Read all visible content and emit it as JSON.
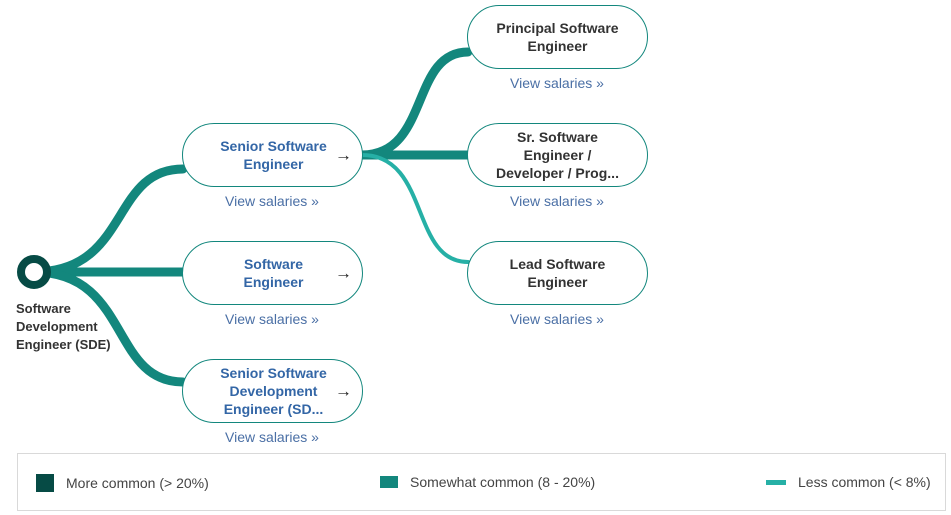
{
  "origin": {
    "label": "Software Development Engineer (SDE)"
  },
  "nodes": [
    {
      "title": "Senior Software Engineer",
      "link": "View salaries »",
      "arrow": "→"
    },
    {
      "title": "Software Engineer",
      "link": "View salaries »",
      "arrow": "→"
    },
    {
      "title": "Senior Software Development Engineer (SD...",
      "link": "View salaries »",
      "arrow": "→"
    },
    {
      "title": "Principal Software Engineer",
      "link": "View salaries »"
    },
    {
      "title": "Sr. Software Engineer / Developer / Prog...",
      "link": "View salaries »"
    },
    {
      "title": "Lead Software Engineer",
      "link": "View salaries »"
    }
  ],
  "legend": [
    {
      "label": "More common (> 20%)",
      "color": "#064b45"
    },
    {
      "label": "Somewhat common (8 - 20%)",
      "color": "#13877d"
    },
    {
      "label": "Less common (< 8%)",
      "color": "#26b0a6"
    }
  ],
  "colors": {
    "node_border": "#13877d",
    "active_text": "#3366a6",
    "link": "#4a6fa5"
  }
}
